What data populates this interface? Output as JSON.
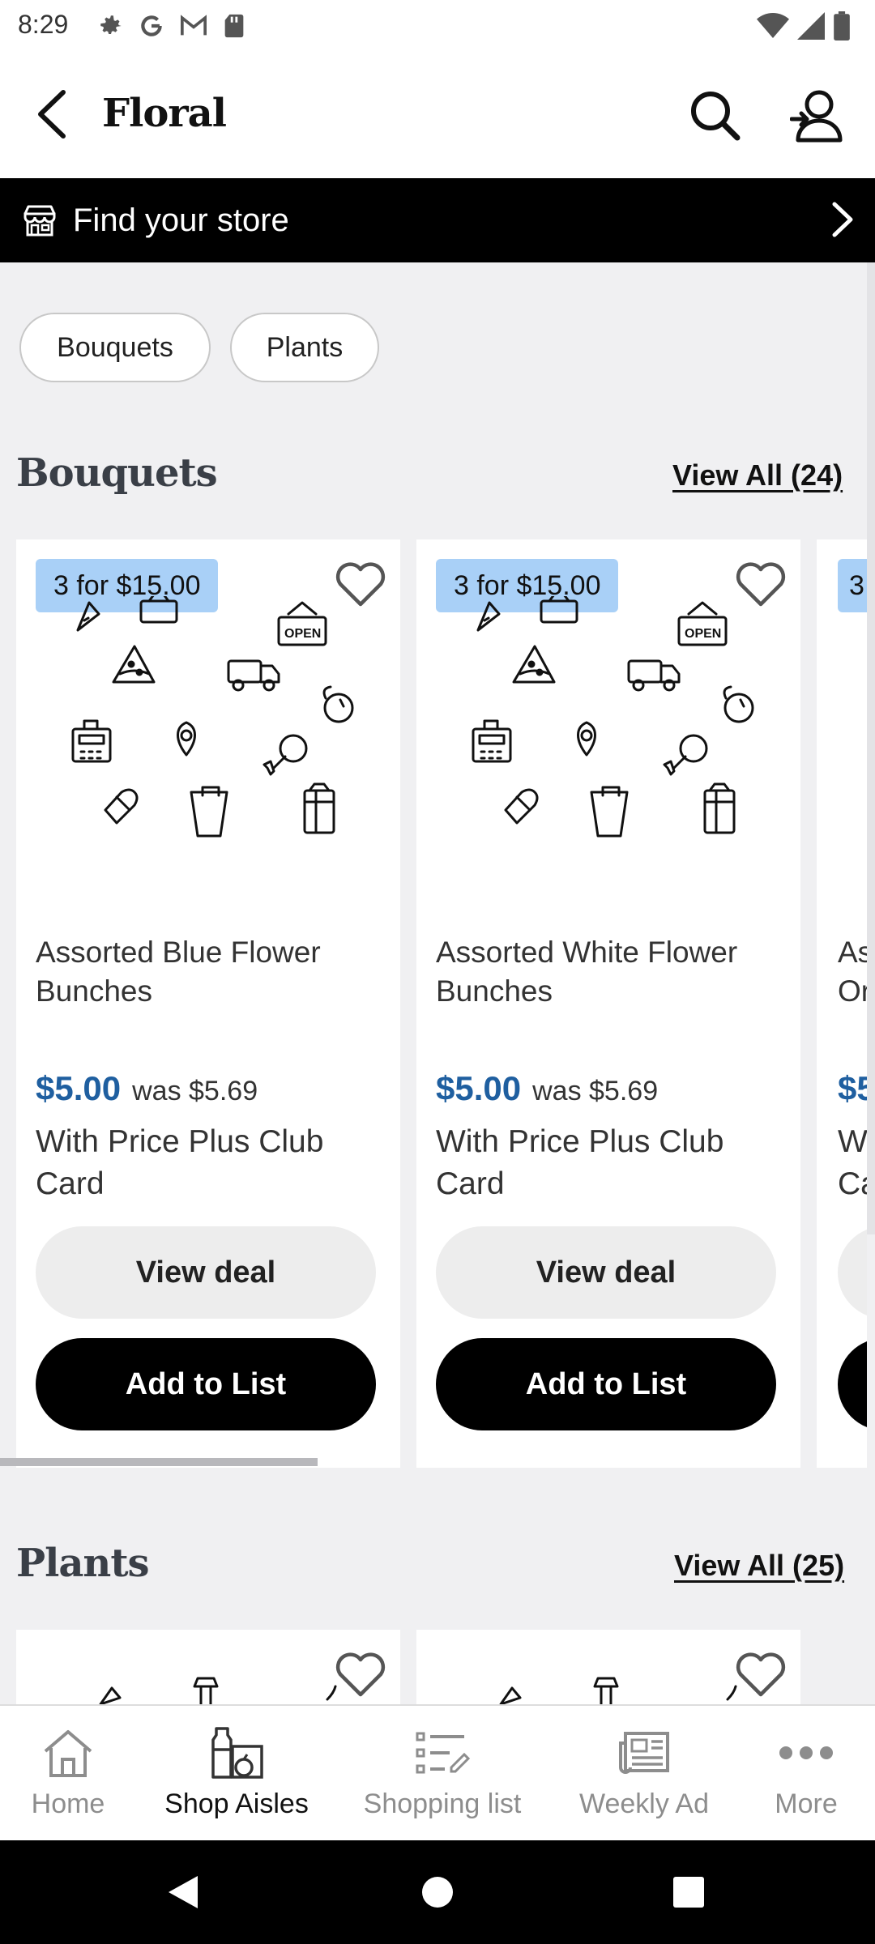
{
  "status_bar": {
    "time": "8:29"
  },
  "header": {
    "title": "Floral"
  },
  "store_bar": {
    "label": "Find your store"
  },
  "chips": [
    "Bouquets",
    "Plants"
  ],
  "sections": {
    "bouquets": {
      "title": "Bouquets",
      "view_all": "View All (24)",
      "products": [
        {
          "badge": "3 for $15.00",
          "name": "Assorted Blue Flower Bunches",
          "price": "$5.00",
          "was_price": "was $5.69",
          "club_text": "With Price Plus Club Card",
          "view_deal_label": "View deal",
          "add_label": "Add to List"
        },
        {
          "badge": "3 for $15.00",
          "name": "Assorted White Flower Bunches",
          "price": "$5.00",
          "was_price": "was $5.69",
          "club_text": "With Price Plus Club Card",
          "view_deal_label": "View deal",
          "add_label": "Add to List"
        },
        {
          "badge": "3",
          "name": "Ass Or",
          "price": "$5",
          "club_text": "Wi Ca"
        }
      ]
    },
    "plants": {
      "title": "Plants",
      "view_all": "View All (25)"
    }
  },
  "bottom_nav": {
    "items": [
      {
        "label": "Home",
        "icon": "home-icon",
        "active": false
      },
      {
        "label": "Shop Aisles",
        "icon": "shop-aisles-icon",
        "active": true
      },
      {
        "label": "Shopping list",
        "icon": "shopping-list-icon",
        "active": false
      },
      {
        "label": "Weekly Ad",
        "icon": "weekly-ad-icon",
        "active": false
      },
      {
        "label": "More",
        "icon": "more-icon",
        "active": false
      }
    ]
  },
  "colors": {
    "badge": "#a9d0f7",
    "sale_price": "#1f5fa0",
    "page_background": "#f0f0f2",
    "store_bar": "#000000"
  }
}
